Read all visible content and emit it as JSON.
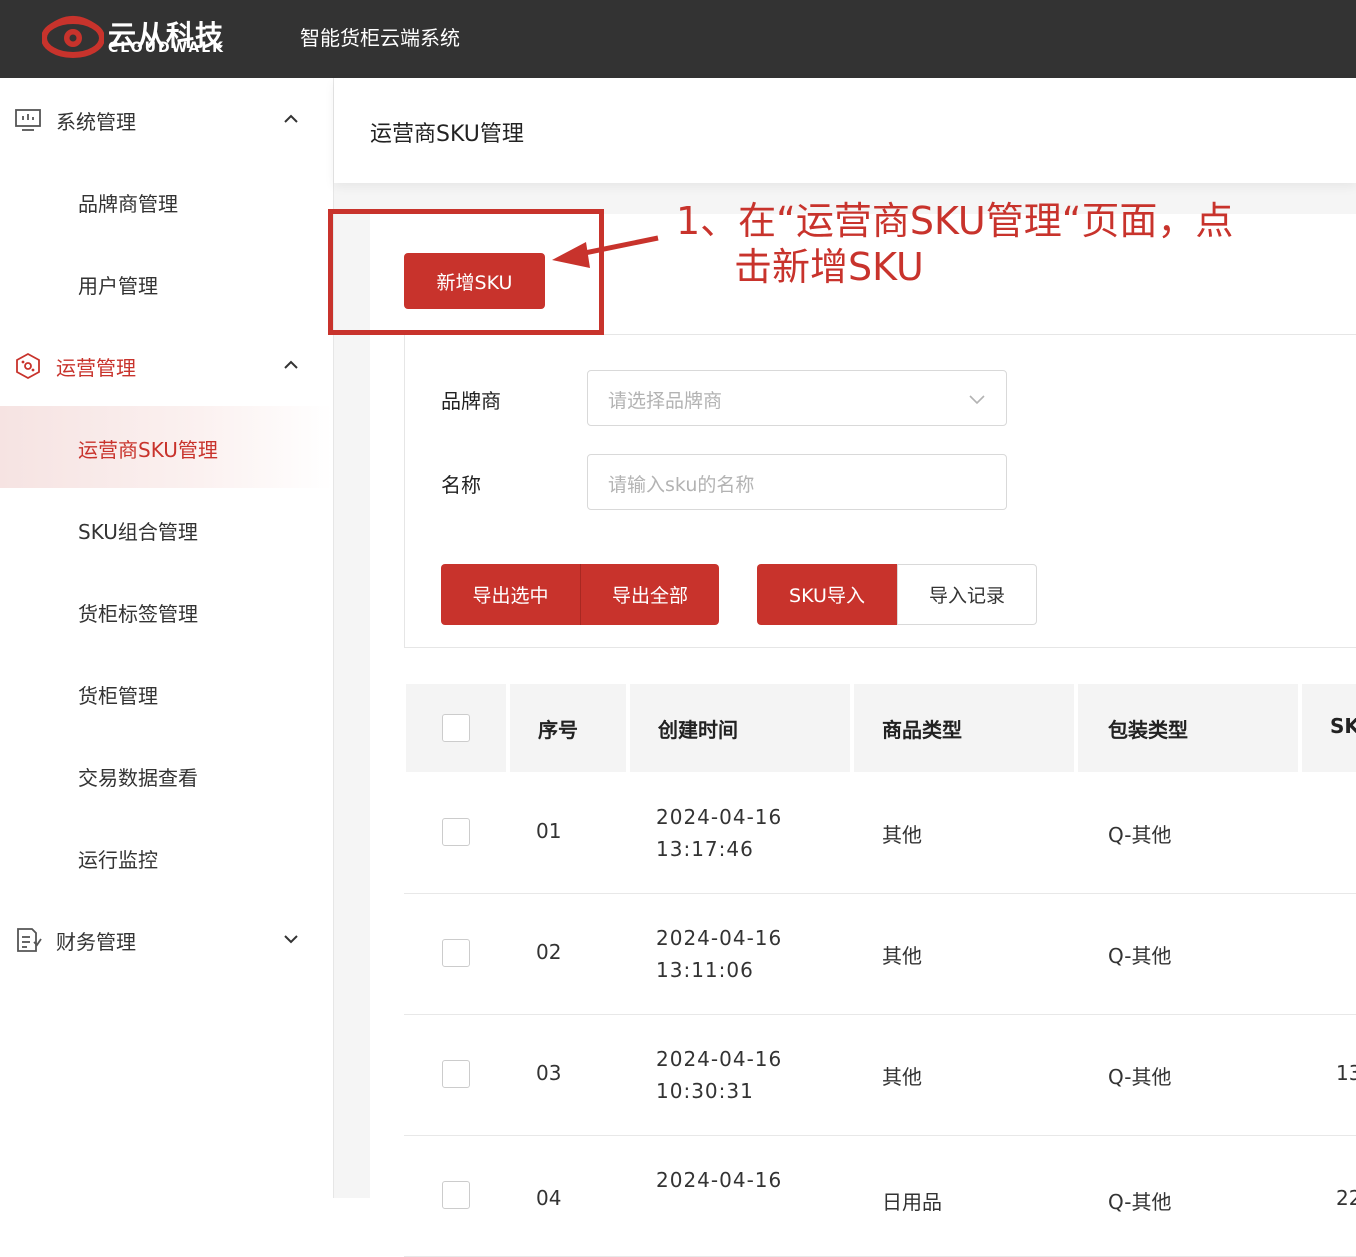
{
  "header": {
    "logo_cn": "云从科技",
    "logo_en": "CLOUDWALK",
    "system_title": "智能货柜云端系统"
  },
  "sidebar": {
    "groups": [
      {
        "label": "系统管理",
        "icon": "monitor-icon",
        "expanded": true
      },
      {
        "label": "运营管理",
        "icon": "operations-icon",
        "expanded": true
      },
      {
        "label": "财务管理",
        "icon": "finance-icon",
        "expanded": false
      }
    ],
    "items": [
      {
        "label": "品牌商管理"
      },
      {
        "label": "用户管理"
      },
      {
        "label": "运营商SKU管理"
      },
      {
        "label": "SKU组合管理"
      },
      {
        "label": "货柜标签管理"
      },
      {
        "label": "货柜管理"
      },
      {
        "label": "交易数据查看"
      },
      {
        "label": "运行监控"
      }
    ],
    "active_item": "运营商SKU管理"
  },
  "page": {
    "title": "运营商SKU管理",
    "add_button": "新增SKU"
  },
  "filters": {
    "brand_label": "品牌商",
    "brand_placeholder": "请选择品牌商",
    "name_label": "名称",
    "name_placeholder": "请输入sku的名称"
  },
  "actions": {
    "export_selected": "导出选中",
    "export_all": "导出全部",
    "sku_import": "SKU导入",
    "import_records": "导入记录"
  },
  "table": {
    "columns": [
      "序号",
      "创建时间",
      "商品类型",
      "包装类型",
      "SK"
    ],
    "rows": [
      {
        "index": "01",
        "date": "2024-04-16",
        "time": "13:17:46",
        "goods_type": "其他",
        "pack_type": "Q-其他",
        "sku": ""
      },
      {
        "index": "02",
        "date": "2024-04-16",
        "time": "13:11:06",
        "goods_type": "其他",
        "pack_type": "Q-其他",
        "sku": ""
      },
      {
        "index": "03",
        "date": "2024-04-16",
        "time": "10:30:31",
        "goods_type": "其他",
        "pack_type": "Q-其他",
        "sku": "13"
      },
      {
        "index": "04",
        "date": "2024-04-16",
        "time": "",
        "goods_type": "日用品",
        "pack_type": "Q-其他",
        "sku": "22"
      }
    ]
  },
  "annotation": {
    "line1": "1、在“运营商SKU管理“页面，点",
    "line2": "击新增SKU"
  },
  "colors": {
    "brand_red": "#c8332c",
    "topbar": "#333333",
    "collapse_tab": "#e02a20"
  }
}
